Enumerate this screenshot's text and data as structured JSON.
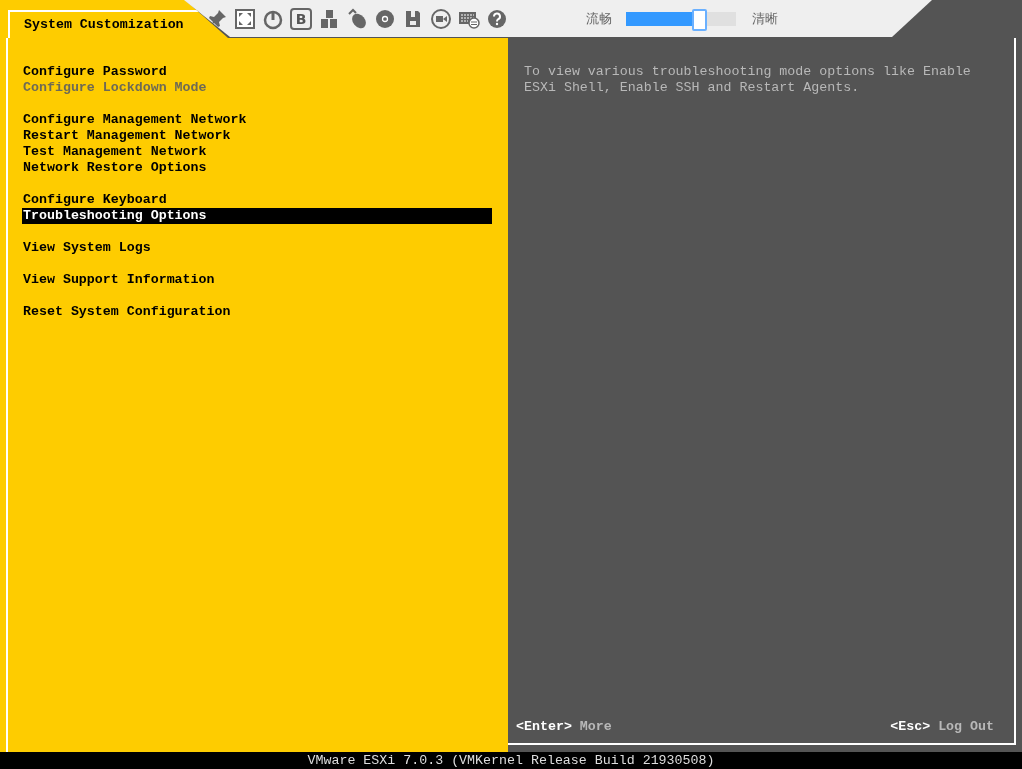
{
  "window": {
    "title": "System Customization"
  },
  "toolbar": {
    "letter_button": "B",
    "quality_slider": {
      "left_label": "流畅",
      "right_label": "清晰",
      "level": 0.67
    }
  },
  "menu": {
    "groups": [
      [
        {
          "label": "Configure Password",
          "disabled": false,
          "selected": false
        },
        {
          "label": "Configure Lockdown Mode",
          "disabled": true,
          "selected": false
        }
      ],
      [
        {
          "label": "Configure Management Network",
          "disabled": false,
          "selected": false
        },
        {
          "label": "Restart Management Network",
          "disabled": false,
          "selected": false
        },
        {
          "label": "Test Management Network",
          "disabled": false,
          "selected": false
        },
        {
          "label": "Network Restore Options",
          "disabled": false,
          "selected": false
        }
      ],
      [
        {
          "label": "Configure Keyboard",
          "disabled": false,
          "selected": false
        },
        {
          "label": "Troubleshooting Options",
          "disabled": false,
          "selected": true
        }
      ],
      [
        {
          "label": "View System Logs",
          "disabled": false,
          "selected": false
        }
      ],
      [
        {
          "label": "View Support Information",
          "disabled": false,
          "selected": false
        }
      ],
      [
        {
          "label": "Reset System Configuration",
          "disabled": false,
          "selected": false
        }
      ]
    ]
  },
  "description": "To view various troubleshooting mode options like Enable ESXi Shell, Enable SSH and Restart Agents.",
  "hints": [
    {
      "key": "<Enter>",
      "action": "More"
    },
    {
      "key": "<Esc>",
      "action": "Log Out"
    }
  ],
  "status_bar": "VMware ESXi 7.0.3 (VMKernel Release Build 21930508)"
}
